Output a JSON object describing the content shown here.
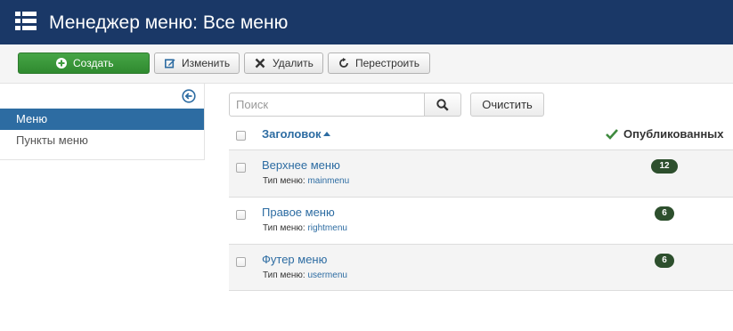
{
  "header": {
    "title": "Менеджер меню: Все меню",
    "icon": "list-icon"
  },
  "toolbar": {
    "create_label": "Создать",
    "edit_label": "Изменить",
    "delete_label": "Удалить",
    "rebuild_label": "Перестроить"
  },
  "sidebar": {
    "items": [
      {
        "label": "Меню",
        "active": true
      },
      {
        "label": "Пункты меню",
        "active": false
      }
    ]
  },
  "search": {
    "placeholder": "Поиск",
    "value": "",
    "clear_label": "Очистить"
  },
  "table": {
    "header_title": "Заголовок",
    "header_published": "Опубликованных",
    "type_prefix": "Тип меню:",
    "rows": [
      {
        "title": "Верхнее меню",
        "menutype": "mainmenu",
        "published": "12"
      },
      {
        "title": "Правое меню",
        "menutype": "rightmenu",
        "published": "6"
      },
      {
        "title": "Футер меню",
        "menutype": "usermenu",
        "published": "6"
      }
    ]
  },
  "colors": {
    "header_bg": "#1a3867",
    "accent": "#2d6ca2",
    "create_button": "#3e9a3e",
    "badge": "#2d4f2d"
  }
}
